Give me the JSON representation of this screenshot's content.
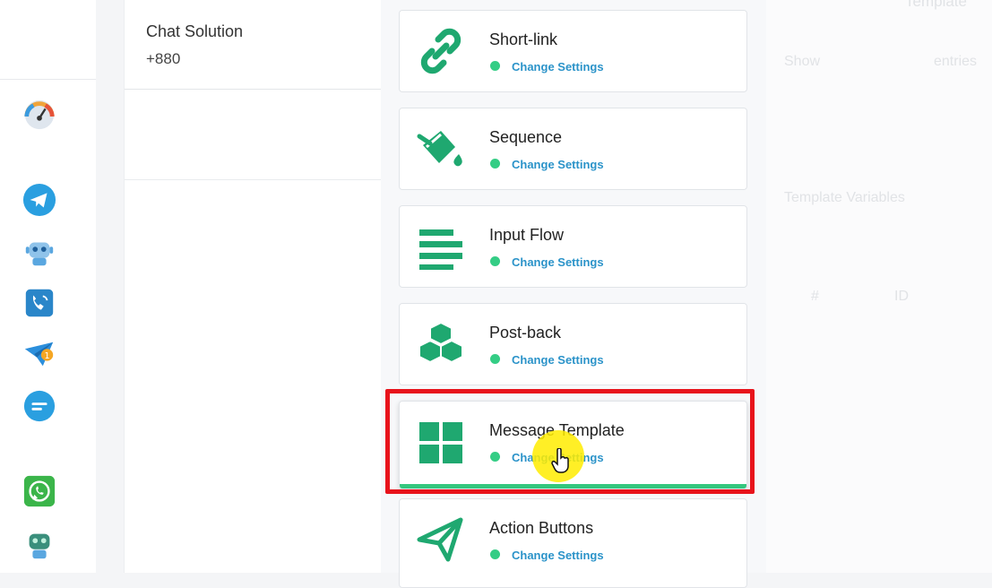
{
  "rail": {
    "icons": [
      "dashboard-gauge-icon",
      "telegram-icon",
      "bot-icon",
      "voice-call-icon",
      "broadcast-plane-icon",
      "chat-bubble-icon",
      "whatsapp-icon",
      "bot-head-icon"
    ],
    "badge": "1"
  },
  "account": {
    "name": "Chat Solution",
    "phone": "+880"
  },
  "settings": {
    "cards": [
      {
        "title": "Short-link",
        "link": "Change Settings",
        "icon": "link-icon"
      },
      {
        "title": "Sequence",
        "link": "Change Settings",
        "icon": "paint-bucket-icon"
      },
      {
        "title": "Input Flow",
        "link": "Change Settings",
        "icon": "align-lines-icon"
      },
      {
        "title": "Post-back",
        "link": "Change Settings",
        "icon": "cubes-icon"
      },
      {
        "title": "Message Template",
        "link": "Change Settings",
        "icon": "grid-icon"
      },
      {
        "title": "Action Buttons",
        "link": "Change Settings",
        "icon": "paper-plane-icon"
      }
    ]
  },
  "colors": {
    "icon_green": "#1fa870",
    "status_green": "#34cd85",
    "link_blue": "#2b93c9",
    "highlight_red": "#e8131b"
  },
  "right_panel": {
    "top_text": "Template",
    "show_label": "Show",
    "entries_label": "entries",
    "variables_heading": "Template Variables",
    "col_hash": "#",
    "col_id": "ID"
  }
}
